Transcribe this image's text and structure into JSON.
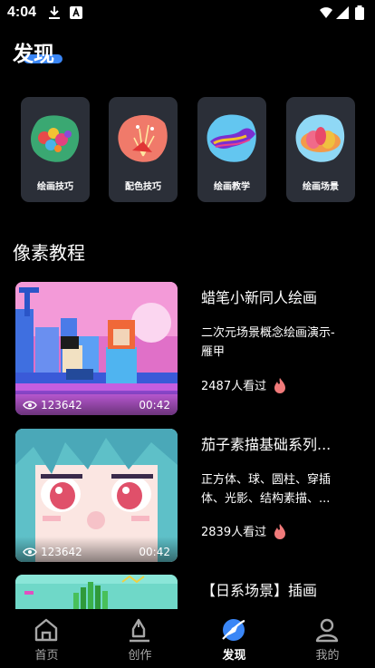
{
  "status_bar": {
    "time": "4:04"
  },
  "header": {
    "title": "发现"
  },
  "categories": [
    {
      "label": "绘画技巧"
    },
    {
      "label": "配色技巧"
    },
    {
      "label": "绘画教学"
    },
    {
      "label": "绘画场景"
    }
  ],
  "section": {
    "title": "像素教程"
  },
  "courses": [
    {
      "title": "蜡笔小新同人绘画",
      "desc": "二次元场景概念绘画演示-雁甲",
      "views": "123642",
      "duration": "00:42",
      "watchers": "2487人看过"
    },
    {
      "title": "茄子素描基础系列...",
      "desc": "正方体、球、圆柱、穿插体、光影、结构素描、...",
      "views": "123642",
      "duration": "00:42",
      "watchers": "2839人看过"
    },
    {
      "title": "【日系场景】插画"
    }
  ],
  "bottom_nav": [
    {
      "label": "首页",
      "icon": "home-icon"
    },
    {
      "label": "创作",
      "icon": "pen-icon"
    },
    {
      "label": "发现",
      "icon": "compass-icon",
      "active": true
    },
    {
      "label": "我的",
      "icon": "user-icon"
    }
  ],
  "colors": {
    "accent": "#3a86f6",
    "card": "#2b2f38",
    "fire": "#f07a7a"
  }
}
